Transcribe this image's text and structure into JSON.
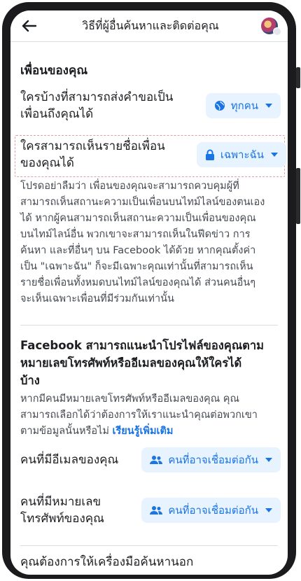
{
  "header": {
    "title": "วิธีที่ผู้อื่นค้นหาและติดต่อคุณ"
  },
  "friends": {
    "heading": "เพื่อนของคุณ",
    "friend_request_label_line1": "ใครบ้างที่สามารถส่งคำขอเป็น",
    "friend_request_label_line2": "เพื่อนถึงคุณได้",
    "friend_request_value": "ทุกคน",
    "friend_list_label_line1": "ใครสามารถเห็นรายชื่อเพื่อน",
    "friend_list_label_line2": "ของคุณได้",
    "friend_list_value": "เฉพาะฉัน",
    "description": [
      "โปรดอย่าลืมว่า เพื่อนของคุณจะสามารถควบคุมผู้ที่",
      "สามารถเห็นสถานะความเป็นเพื่อนบนไทม์ไลน์ของตนเอง",
      "ได้ หากผู้คนสามารถเห็นสถานะความเป็นเพื่อนของคุณ",
      "บนไทม์ไลน์อื่น พวกเขาจะสามารถเห็นในฟีดข่าว การ",
      "ค้นหา และที่อื่นๆ บน Facebook ได้ด้วย หากคุณตั้งค่า",
      "เป็น \"เฉพาะฉัน\" ก็จะมีเฉพาะคุณเท่านั้นที่สามารถเห็น",
      "รายชื่อเพื่อนทั้งหมดบนไทม์ไลน์ของคุณได้ ส่วนคนอื่นๆ",
      "จะเห็นเฉพาะเพื่อนที่มีร่วมกันเท่านั้น"
    ]
  },
  "lookup": {
    "heading_line1": "Facebook สามารถแนะนำโปรไฟล์ของคุณตาม",
    "heading_line2": "หมายเลขโทรศัพท์หรืออีเมลของคุณให้ใครได้",
    "heading_line3": "บ้าง",
    "desc_line1": "หากมีคนมีหมายเลขโทรศัพท์หรืออีเมลของคุณ คุณ",
    "desc_line2": "สามารถเลือกได้ว่าต้องการให้เราแนะนำคุณต่อพวกเขา",
    "desc_line3": "ตามข้อมูลนั้นหรือไม่",
    "learn_more": "เรียนรู้เพิ่มเติม",
    "email_label": "คนที่มีอีเมลของคุณ",
    "email_value": "คนที่อาจเชื่อมต่อกัน",
    "phone_label_line1": "คนที่มีหมายเลข",
    "phone_label_line2": "โทรศัพท์ของคุณ",
    "phone_value": "คนที่อาจเชื่อมต่อกัน"
  },
  "search_engine": {
    "label_partial": "คุณต้องการให้เครื่องมือค้นหานอก"
  },
  "colors": {
    "accent": "#1b74e4",
    "pill_bg": "#e7f3ff",
    "highlight_border": "#e0a0a8"
  }
}
